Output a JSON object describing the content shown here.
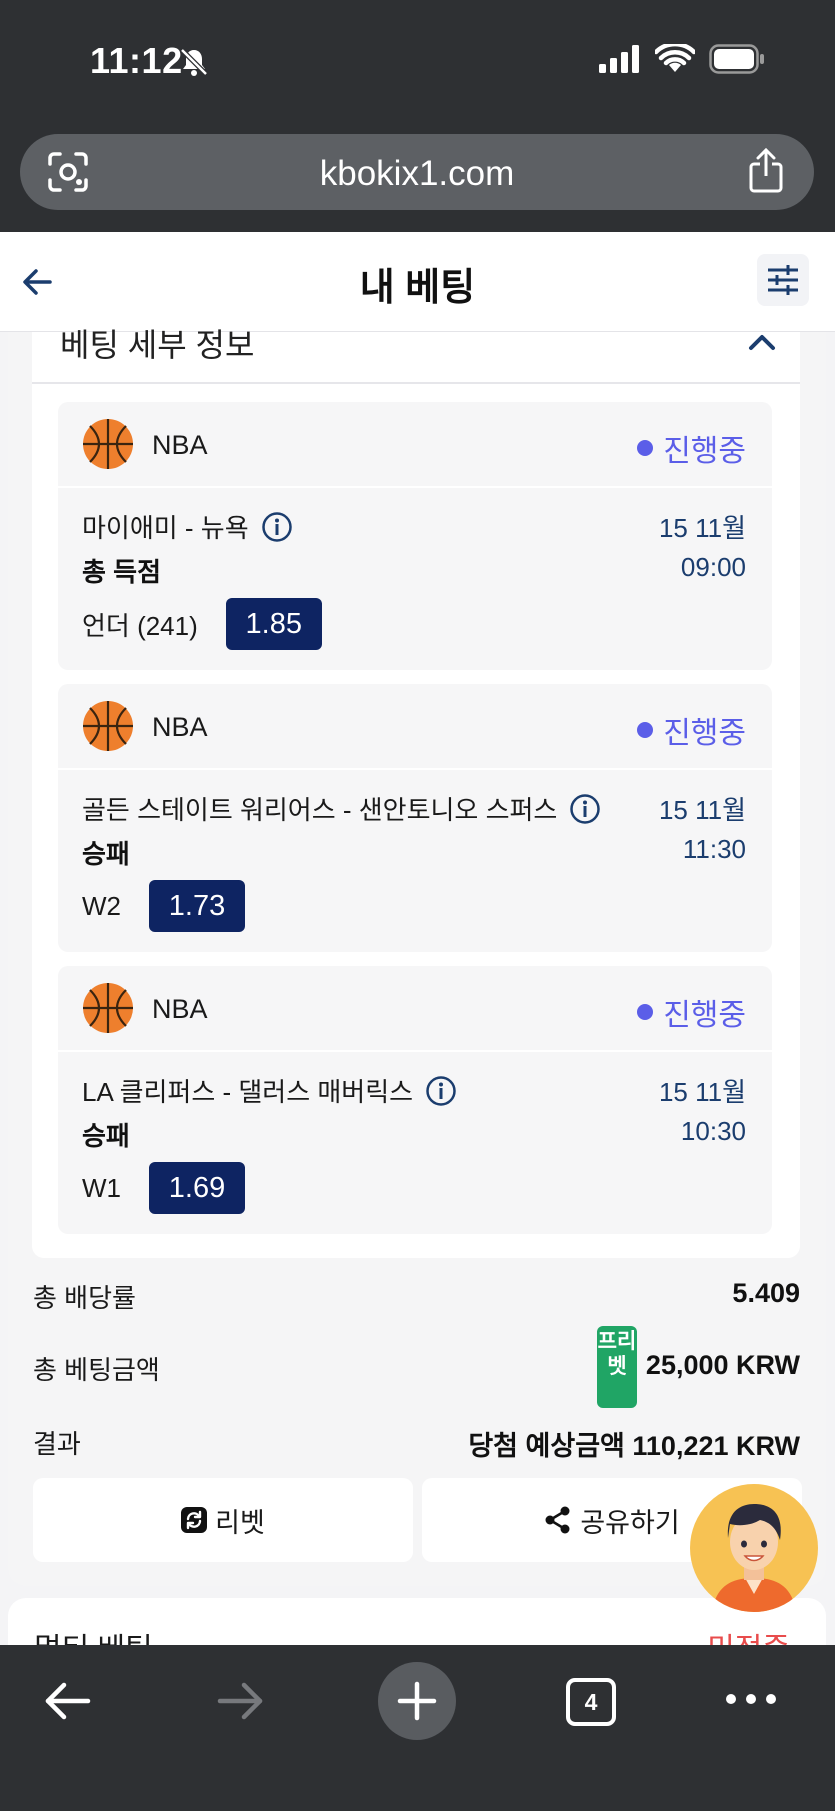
{
  "status_bar": {
    "time": "11:12"
  },
  "browser": {
    "url": "kbokix1.com",
    "open_tabs": "4"
  },
  "header": {
    "title": "내 베팅"
  },
  "details": {
    "section_title": "베팅 세부 정보",
    "bets": [
      {
        "league": "NBA",
        "status": "진행중",
        "match": "마이애미 - 뉴욕",
        "market": "총 득점",
        "date": "15 11월",
        "time": "09:00",
        "selection": "언더 (241)",
        "odds": "1.85"
      },
      {
        "league": "NBA",
        "status": "진행중",
        "match": "골든 스테이트 워리어스 - 샌안토니오 스퍼스",
        "market": "승패",
        "date": "15 11월",
        "time": "11:30",
        "selection": "W2",
        "odds": "1.73"
      },
      {
        "league": "NBA",
        "status": "진행중",
        "match": "LA 클리퍼스 - 댈러스 매버릭스",
        "market": "승패",
        "date": "15 11월",
        "time": "10:30",
        "selection": "W1",
        "odds": "1.69"
      }
    ]
  },
  "summary": {
    "total_odds_label": "총 배당률",
    "total_odds_value": "5.409",
    "total_stake_label": "총 베팅금액",
    "free_bet_badge": "프리벳",
    "total_stake_value": "25,000 KRW",
    "result_label": "결과",
    "result_value": "당첨 예상금액 110,221 KRW"
  },
  "actions": {
    "rebet": "리벳",
    "share": "공유하기"
  },
  "next_card": {
    "title": "멀티 베팅",
    "status": "미정중"
  },
  "colors": {
    "accent": "#5b5ee8",
    "odds_bg": "#0e2462",
    "free_bet": "#20a565",
    "pending": "#e84c4c"
  }
}
